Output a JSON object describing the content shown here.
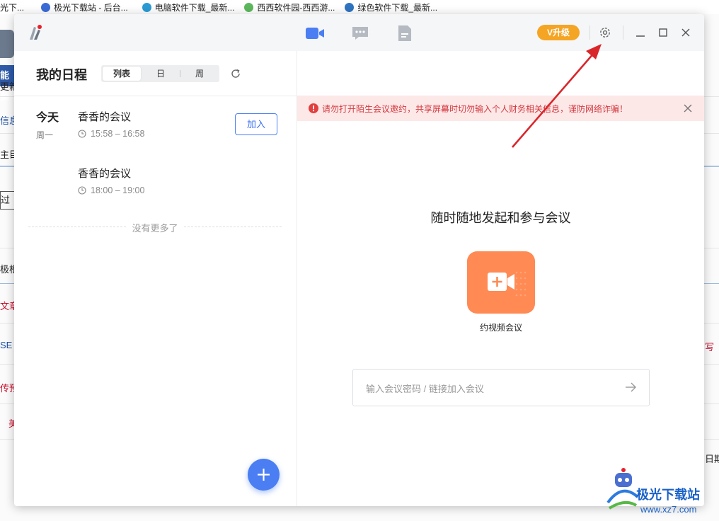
{
  "browser": {
    "bookmarks": [
      {
        "label": "光下..."
      },
      {
        "label": "极光下载站 - 后台..."
      },
      {
        "label": "电脑软件下载_最新..."
      },
      {
        "label": "西西软件园-西西游..."
      },
      {
        "label": "绿色软件下载_最新..."
      }
    ]
  },
  "background_app": {
    "left_fragments": [
      "能菜",
      "更新",
      "信息",
      "主目.",
      "过",
      "极根",
      "文章",
      "SE",
      "传预",
      "美"
    ],
    "right_fragments": [
      "写",
      "日期"
    ]
  },
  "window": {
    "upgrade_label": "V升级",
    "nav": [
      {
        "icon": "video-camera-icon",
        "active": true
      },
      {
        "icon": "chat-icon",
        "active": false
      },
      {
        "icon": "document-icon",
        "active": false
      }
    ]
  },
  "schedule": {
    "title": "我的日程",
    "views": [
      "列表",
      "日",
      "周"
    ],
    "active_view": "列表",
    "day_label": "今天",
    "weekday": "周一",
    "meetings": [
      {
        "title": "香香的会议",
        "time": "15:58 – 16:58",
        "join_label": "加入"
      },
      {
        "title": "香香的会议",
        "time": "18:00 – 19:00"
      }
    ],
    "no_more": "没有更多了"
  },
  "meeting_panel": {
    "warning": "请勿打开陌生会议邀约，共享屏幕时切勿输入个人财务相关信息，谨防网络诈骗！",
    "headline": "随时随地发起和参与会议",
    "video_meeting_label": "约视频会议",
    "code_placeholder": "输入会议密码 / 链接加入会议"
  },
  "watermark": {
    "name": "极光下载站",
    "url": "www.xz7.com"
  },
  "colors": {
    "accent": "#4a7ef2",
    "video_btn": "#ff8a54",
    "upgrade": "#f5a524",
    "warning_text": "#d3393f",
    "warning_bg": "#fde8e8",
    "annotation": "#d9262b"
  }
}
